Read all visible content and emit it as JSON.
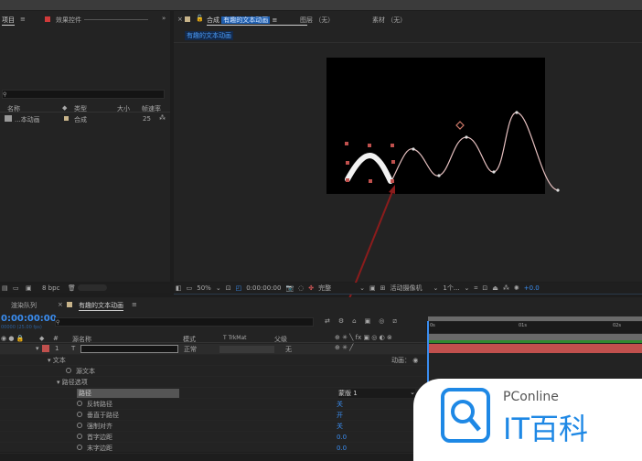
{
  "left_panel": {
    "tab_project": "项目",
    "tab_effects": "效果控件",
    "col_name": "名称",
    "col_type": "类型",
    "col_size": "大小",
    "col_fps": "帧速率",
    "item": {
      "name": "...本动画",
      "type": "合成",
      "fps": "25"
    },
    "bpc": "8 bpc"
  },
  "viewer": {
    "tab_comp_prefix": "合成",
    "comp_name": "有趣的文本动画",
    "tab_layer": "图层 （无）",
    "tab_footage": "素材 （无）",
    "breadcrumb": "有趣的文本动画",
    "zoom": "50%",
    "timecode": "0:00:00:00",
    "quality": "完整",
    "camera": "活动摄像机",
    "views": "1个...",
    "exposure": "+0.0"
  },
  "timeline": {
    "tab_render": "渲染队列",
    "tab_comp": "有趣的文本动画",
    "timecode": "0:00:00:00",
    "fps_sub": "00000 (25.00 fps)",
    "headers": {
      "source": "源名称",
      "mode": "模式",
      "trkmat": "T  TrkMat",
      "parent": "父级"
    },
    "layer": {
      "index": "1",
      "type": "T",
      "mode": "正常",
      "parent": "无"
    },
    "ruler": [
      "0s",
      "01s",
      "02s"
    ],
    "animate": "动画：",
    "props": [
      {
        "label": "文本",
        "value": ""
      },
      {
        "label": "源文本",
        "value": ""
      },
      {
        "label": "路径选项",
        "value": ""
      },
      {
        "label": "路径",
        "value": "蒙版 1"
      },
      {
        "label": "反转路径",
        "value": "关"
      },
      {
        "label": "垂直于路径",
        "value": "开"
      },
      {
        "label": "强制对齐",
        "value": "关"
      },
      {
        "label": "首字边距",
        "value": "0.0"
      },
      {
        "label": "末字边距",
        "value": "0.0"
      }
    ]
  },
  "watermark": {
    "brand": "PConline",
    "name": "IT百科"
  },
  "colors": {
    "accent": "#3a8df0",
    "highlight": "#8b1c1c",
    "layer_bar": "#c0504d"
  }
}
